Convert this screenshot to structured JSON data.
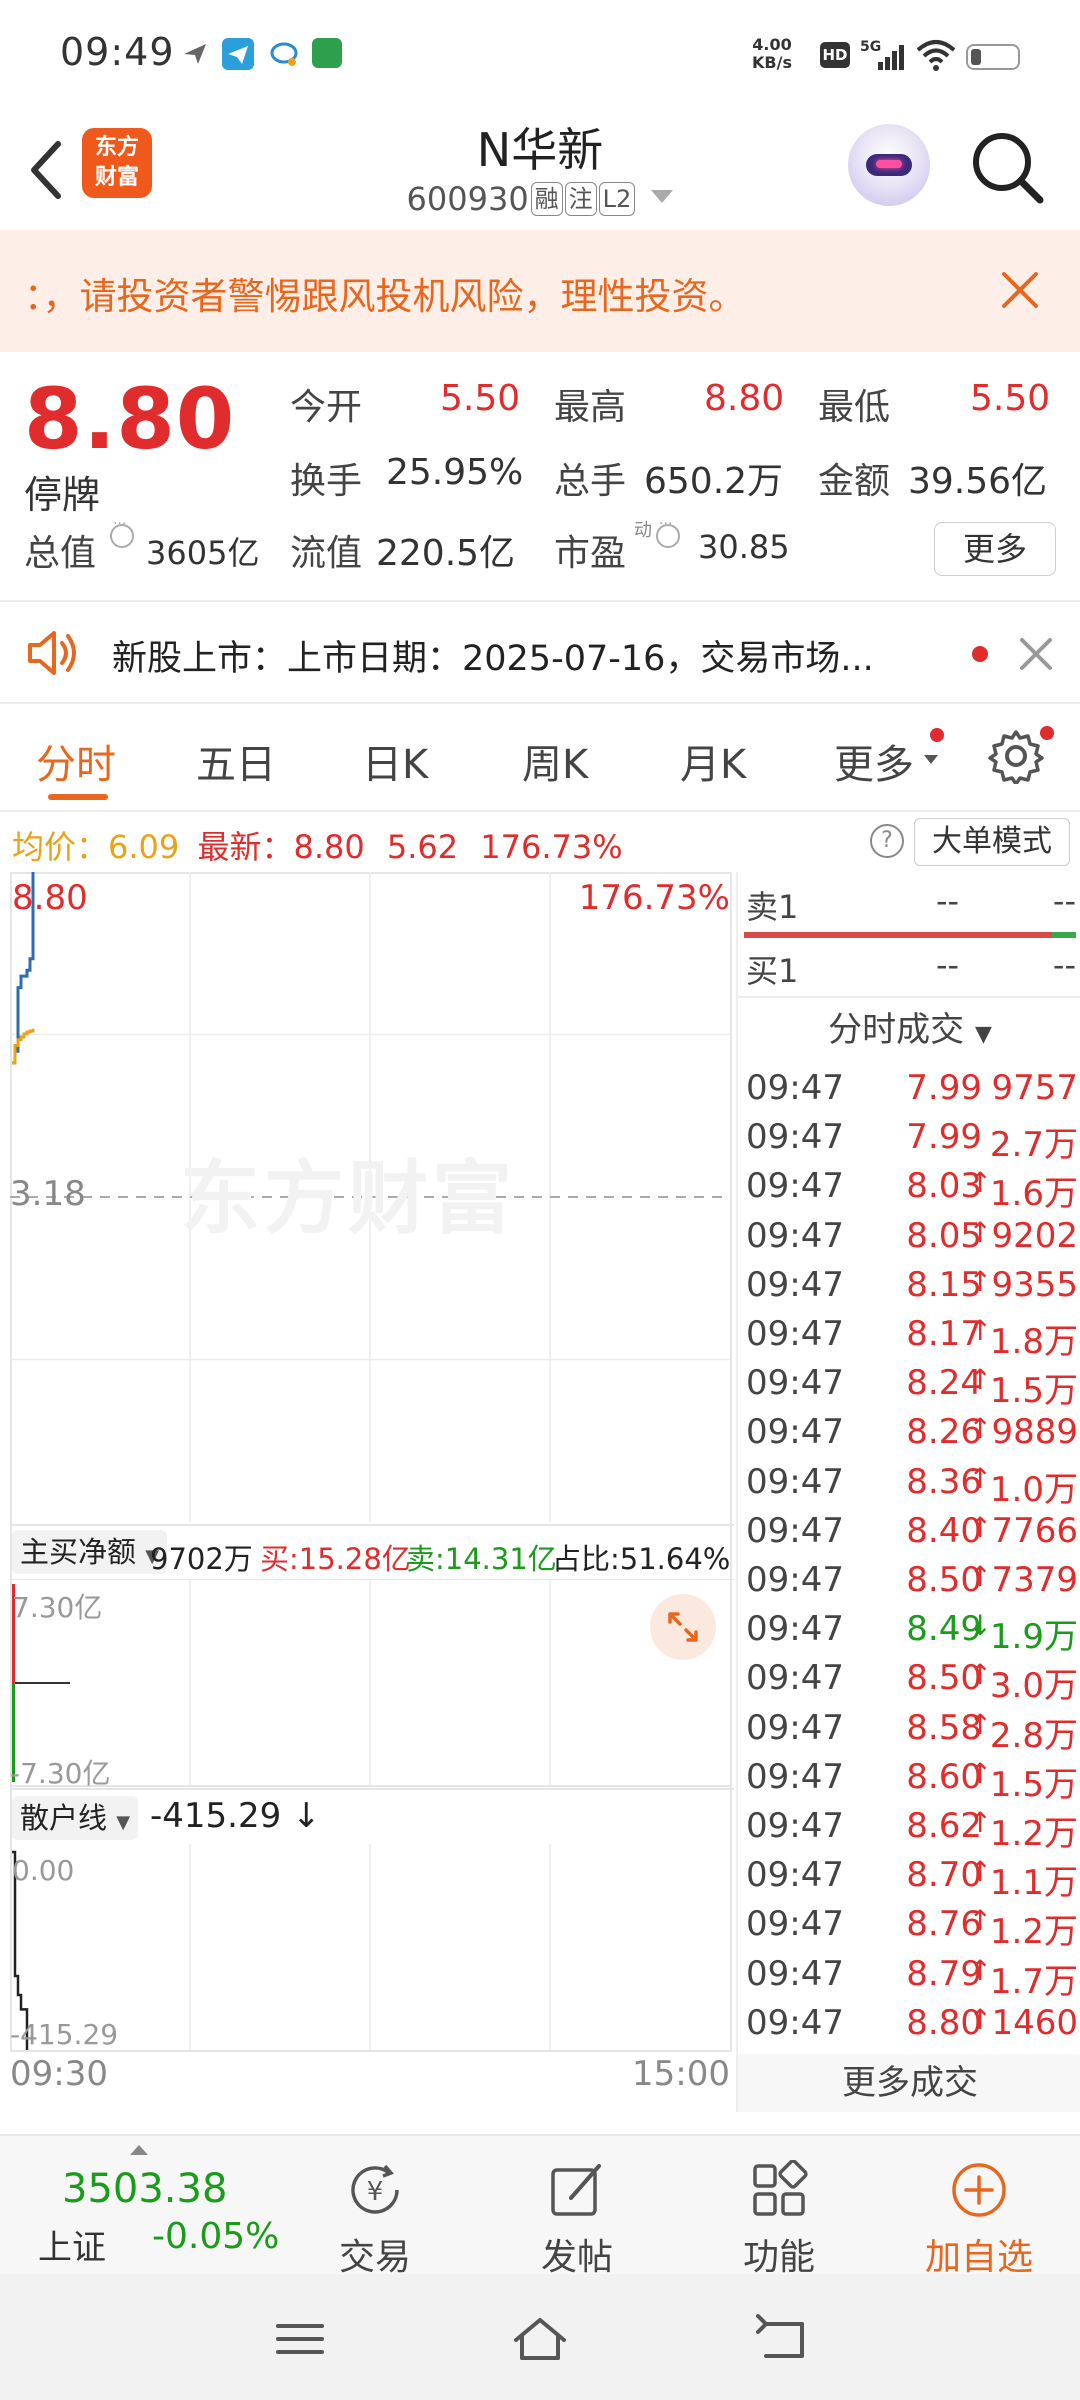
{
  "status_bar": {
    "time": "09:49",
    "net_speed_value": "4.00",
    "net_speed_unit": "KB/s",
    "hd_label": "HD",
    "network": "5G"
  },
  "header": {
    "logo_text_line1": "东方",
    "logo_text_line2": "财富",
    "stock_name": "N华新",
    "stock_code": "600930",
    "tag_margin": "融",
    "tag_watch": "注",
    "tag_level": "L2"
  },
  "risk_banner": {
    "text": "：，请投资者警惕跟风投机风险，理性投资。"
  },
  "quote": {
    "last_price": "8.80",
    "status": "停牌",
    "open_label": "今开",
    "open_value": "5.50",
    "high_label": "最高",
    "high_value": "8.80",
    "low_label": "最低",
    "low_value": "5.50",
    "turnover_label": "换手",
    "turnover_value": "25.95%",
    "volume_label": "总手",
    "volume_value": "650.2万",
    "amount_label": "金额",
    "amount_value": "39.56亿",
    "mktcap_label": "总值",
    "mktcap_value": "3605亿",
    "float_label": "流值",
    "float_value": "220.5亿",
    "pe_label": "市盈",
    "pe_sup": "动",
    "pe_value": "30.85",
    "more_label": "更多"
  },
  "notice": {
    "text": "新股上市：上市日期：2025-07-16，交易市场..."
  },
  "tabs": [
    {
      "label": "分时",
      "active": true
    },
    {
      "label": "五日",
      "active": false
    },
    {
      "label": "日K",
      "active": false
    },
    {
      "label": "周K",
      "active": false
    },
    {
      "label": "月K",
      "active": false
    },
    {
      "label": "更多",
      "active": false
    }
  ],
  "info_line": {
    "avg_label": "均价：",
    "avg_value": "6.09",
    "latest_label": "最新：",
    "latest_value": "8.80",
    "change_value": "5.62",
    "change_pct": "176.73%",
    "help": "?",
    "big_order_mode": "大单模式"
  },
  "chart": {
    "price_top": "8.80",
    "pct_top": "176.73%",
    "price_mid": "3.18",
    "watermark": "东方财富",
    "fund_selector": "主买净额",
    "fund_net": "9702万",
    "fund_buy": "买:15.28亿",
    "fund_sell": "卖:14.31亿",
    "fund_ratio": "占比:51.64%",
    "fund_top": "7.30亿",
    "fund_bottom": "-7.30亿",
    "retail_selector": "散户线",
    "retail_value": "-415.29",
    "retail_top": "0.00",
    "retail_bottom": "-415.29",
    "time_start": "09:30",
    "time_end": "15:00"
  },
  "chart_data": {
    "type": "line",
    "title": "",
    "xlabel": "",
    "ylabel": "",
    "x_range": [
      "09:30",
      "15:00"
    ],
    "y_range": [
      -2.44,
      8.8
    ],
    "reference_price": 3.18,
    "series": [
      {
        "name": "",
        "color": "#2f6db3",
        "x": [
          "09:30",
          "09:31",
          "09:32",
          "09:33",
          "09:34",
          "09:35",
          "09:36",
          "09:37"
        ],
        "values": [
          5.5,
          5.7,
          6.8,
          7.0,
          7.0,
          7.1,
          7.3,
          8.8
        ]
      },
      {
        "name": "",
        "color": "#e8a317",
        "x": [
          "09:30",
          "09:31",
          "09:32",
          "09:33",
          "09:34",
          "09:35",
          "09:36",
          "09:37"
        ],
        "values": [
          5.5,
          5.8,
          5.9,
          5.95,
          6.0,
          6.03,
          6.05,
          6.09
        ]
      }
    ],
    "fund_flow": {
      "range": [
        -7.3,
        7.3
      ]
    },
    "retail_line": {
      "range": [
        -415.29,
        0.0
      ],
      "x": [
        "09:30",
        "09:31",
        "09:32",
        "09:33",
        "09:34",
        "09:35"
      ],
      "values": [
        0.0,
        -260.0,
        -300.0,
        -330.0,
        -330.0,
        -415.29
      ]
    }
  },
  "order_book": {
    "sell1_label": "卖1",
    "sell1_price": "--",
    "sell1_vol": "--",
    "buy1_label": "买1",
    "buy1_price": "--",
    "buy1_vol": "--"
  },
  "ticks_header": "分时成交",
  "ticks": [
    {
      "time": "09:47",
      "price": "7.99",
      "dir": "",
      "vol": "9757",
      "color": "red"
    },
    {
      "time": "09:47",
      "price": "7.99",
      "dir": "",
      "vol": "2.7万",
      "color": "red"
    },
    {
      "time": "09:47",
      "price": "8.03",
      "dir": "↑",
      "vol": "1.6万",
      "color": "red"
    },
    {
      "time": "09:47",
      "price": "8.05",
      "dir": "↑",
      "vol": "9202",
      "color": "red"
    },
    {
      "time": "09:47",
      "price": "8.15",
      "dir": "↑",
      "vol": "9355",
      "color": "red"
    },
    {
      "time": "09:47",
      "price": "8.17",
      "dir": "↑",
      "vol": "1.8万",
      "color": "red"
    },
    {
      "time": "09:47",
      "price": "8.24",
      "dir": "↑",
      "vol": "1.5万",
      "color": "red"
    },
    {
      "time": "09:47",
      "price": "8.26",
      "dir": "↑",
      "vol": "9889",
      "color": "red"
    },
    {
      "time": "09:47",
      "price": "8.36",
      "dir": "↑",
      "vol": "1.0万",
      "color": "red"
    },
    {
      "time": "09:47",
      "price": "8.40",
      "dir": "↑",
      "vol": "7766",
      "color": "red"
    },
    {
      "time": "09:47",
      "price": "8.50",
      "dir": "↑",
      "vol": "7379",
      "color": "red"
    },
    {
      "time": "09:47",
      "price": "8.49",
      "dir": "↓",
      "vol": "1.9万",
      "color": "green"
    },
    {
      "time": "09:47",
      "price": "8.50",
      "dir": "↑",
      "vol": "3.0万",
      "color": "red"
    },
    {
      "time": "09:47",
      "price": "8.58",
      "dir": "↑",
      "vol": "2.8万",
      "color": "red"
    },
    {
      "time": "09:47",
      "price": "8.60",
      "dir": "↑",
      "vol": "1.5万",
      "color": "red"
    },
    {
      "time": "09:47",
      "price": "8.62",
      "dir": "↑",
      "vol": "1.2万",
      "color": "red"
    },
    {
      "time": "09:47",
      "price": "8.70",
      "dir": "↑",
      "vol": "1.1万",
      "color": "red"
    },
    {
      "time": "09:47",
      "price": "8.76",
      "dir": "↑",
      "vol": "1.2万",
      "color": "red"
    },
    {
      "time": "09:47",
      "price": "8.79",
      "dir": "↑",
      "vol": "1.7万",
      "color": "red"
    },
    {
      "time": "09:47",
      "price": "8.80",
      "dir": "↑",
      "vol": "1460",
      "color": "red"
    }
  ],
  "more_trades": "更多成交",
  "bottom_nav": {
    "index_value": "3503.38",
    "index_name": "上证",
    "index_change": "-0.05%",
    "trade": "交易",
    "trade_glyph": "¥",
    "post": "发帖",
    "features": "功能",
    "add_watch": "加自选"
  },
  "colors": {
    "up": "#e02c2c",
    "down": "#1a9b1a",
    "accent": "#e8671e",
    "price_line": "#2f6db3",
    "avg_line": "#e8a317"
  }
}
